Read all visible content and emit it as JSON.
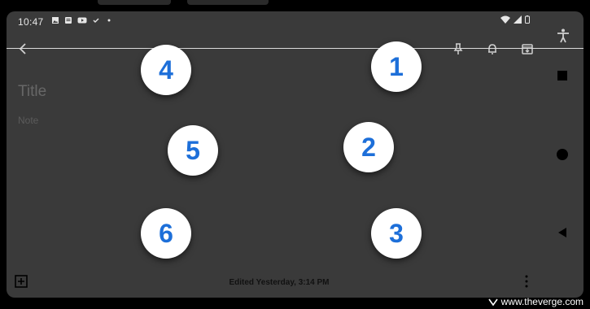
{
  "status_bar": {
    "time": "10:47",
    "left_icons": [
      "image-icon",
      "notes-app-icon",
      "youtube-icon",
      "check-icon",
      "dot-icon"
    ],
    "right_icons": [
      "wifi-icon",
      "signal-icon",
      "battery-icon"
    ]
  },
  "app_bar": {
    "back_icon": "back-arrow-icon",
    "actions": [
      "pin-icon",
      "reminder-bell-icon",
      "archive-icon"
    ]
  },
  "editor": {
    "title_placeholder": "Title",
    "note_placeholder": "Note"
  },
  "nav_rail": {
    "icons": [
      "accessibility-icon",
      "recents-square-icon",
      "home-circle-icon",
      "back-triangle-icon"
    ]
  },
  "bottom_bar": {
    "add_icon": "add-box-icon",
    "edited_text": "Edited Yesterday, 3:14 PM",
    "more_icon": "more-vert-icon"
  },
  "overlay_badges": [
    {
      "label": "4"
    },
    {
      "label": "1"
    },
    {
      "label": "5"
    },
    {
      "label": "2"
    },
    {
      "label": "6"
    },
    {
      "label": "3"
    }
  ],
  "colors": {
    "screen_bg": "#3a3a3a",
    "badge_bg": "#ffffff",
    "badge_digit": "#1d6fd9",
    "icon_fg": "#d0d0d0"
  },
  "watermark": {
    "text": "www.theverge.com"
  }
}
